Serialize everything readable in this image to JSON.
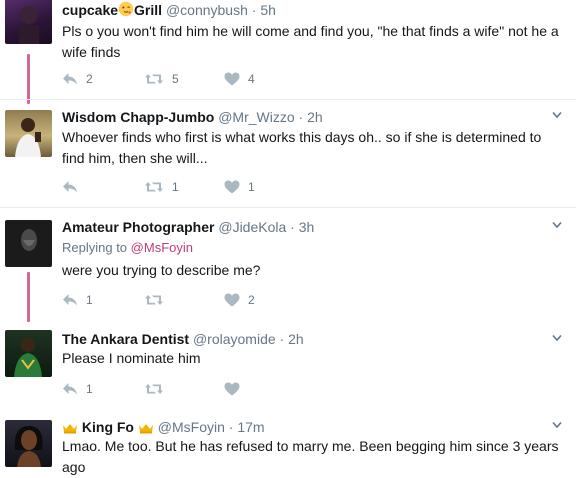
{
  "tweets": [
    {
      "name_pre": "cupcake",
      "name_post": "Grill",
      "handle": "@connybush",
      "sep": "·",
      "time": "5h",
      "text": "Pls o you won't find him he will come and find you, \"he that finds a wife\" not he a wife finds",
      "reply_count": "2",
      "retweet_count": "5",
      "like_count": "4"
    },
    {
      "name": "Wisdom Chapp-Jumbo",
      "handle": "@Mr_Wizzo",
      "sep": "·",
      "time": "2h",
      "text": "Whoever finds who first is what works this days oh.. so if she is determined to find him, then she will...",
      "reply_count": "",
      "retweet_count": "1",
      "like_count": "1"
    },
    {
      "name": "Amateur Photographer",
      "handle": "@JideKola",
      "sep": "·",
      "time": "3h",
      "replying_label": "Replying to",
      "replying_to": "@MsFoyin",
      "text": "were you trying to describe me?",
      "reply_count": "1",
      "retweet_count": "",
      "like_count": "2"
    },
    {
      "name": "The Ankara Dentist",
      "handle": "@rolayomide",
      "sep": "·",
      "time": "2h",
      "text": "Please I nominate him",
      "reply_count": "1",
      "retweet_count": "",
      "like_count": ""
    },
    {
      "name": "King Fo",
      "handle": "@MsFoyin",
      "sep": "·",
      "time": "17m",
      "text": "Lmao. Me too. But he has refused to marry me. Been begging him since 3 years ago"
    }
  ],
  "icons": {
    "reply": "reply-icon",
    "retweet": "retweet-icon",
    "like": "heart-icon",
    "more": "chevron-down-icon",
    "face_emoji": "face-blowing-kiss-emoji",
    "crown_emoji": "crown-emoji"
  },
  "colors": {
    "thread_line": "#d2679b",
    "action_icon": "#aab8c2",
    "secondary_text": "#657786",
    "mention": "#c23b78"
  }
}
